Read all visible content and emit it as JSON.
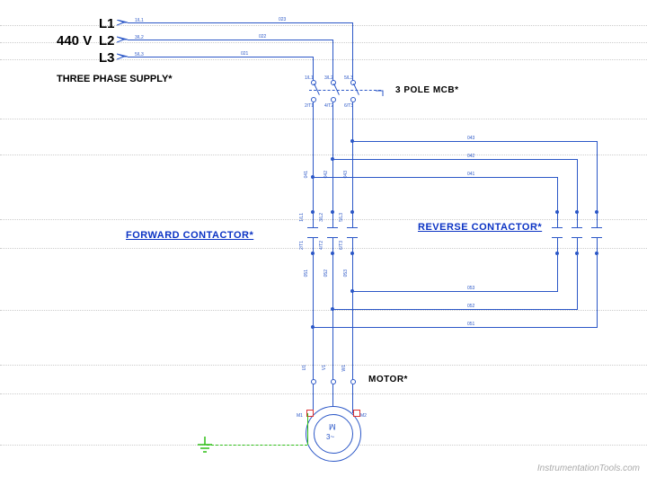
{
  "supply": {
    "phase1": "L1",
    "phase2": "L2",
    "phase3": "L3",
    "voltage": "440 V",
    "label": "THREE PHASE SUPPLY*"
  },
  "mcb": {
    "label": "3 POLE MCB*"
  },
  "contactor_fwd": {
    "label": "FORWARD CONTACTOR*"
  },
  "contactor_rev": {
    "label": "REVERSE CONTACTOR*"
  },
  "motor": {
    "label": "MOTOR*"
  },
  "watermark": "InstrumentationTools.com",
  "wire_tags": {
    "top1": "023",
    "top2": "022",
    "top3": "021",
    "mcb_in1": "1/L1",
    "mcb_in2": "3/L2",
    "mcb_in3": "5/L3",
    "mcb_out1": "2/T1",
    "mcb_out2": "4/T2",
    "mcb_out3": "6/T3",
    "mid1": "041",
    "mid2": "042",
    "mid3": "043",
    "fc_in1": "1/L1",
    "fc_in2": "3/L2",
    "fc_in3": "5/L3",
    "fc_out1": "2/T1",
    "fc_out2": "4/T2",
    "fc_out3": "6/T3",
    "down1": "051",
    "down2": "052",
    "down3": "053",
    "motor_u": "U1",
    "motor_v": "V1",
    "motor_w": "W1",
    "motor_m": "M",
    "motor_3": "3~",
    "motor_m1": "M1",
    "motor_m2": "M2",
    "bus_top": "043",
    "bus_mid": "042",
    "bus_bot": "041",
    "bus_b1": "053",
    "bus_b2": "052",
    "bus_b3": "051"
  }
}
